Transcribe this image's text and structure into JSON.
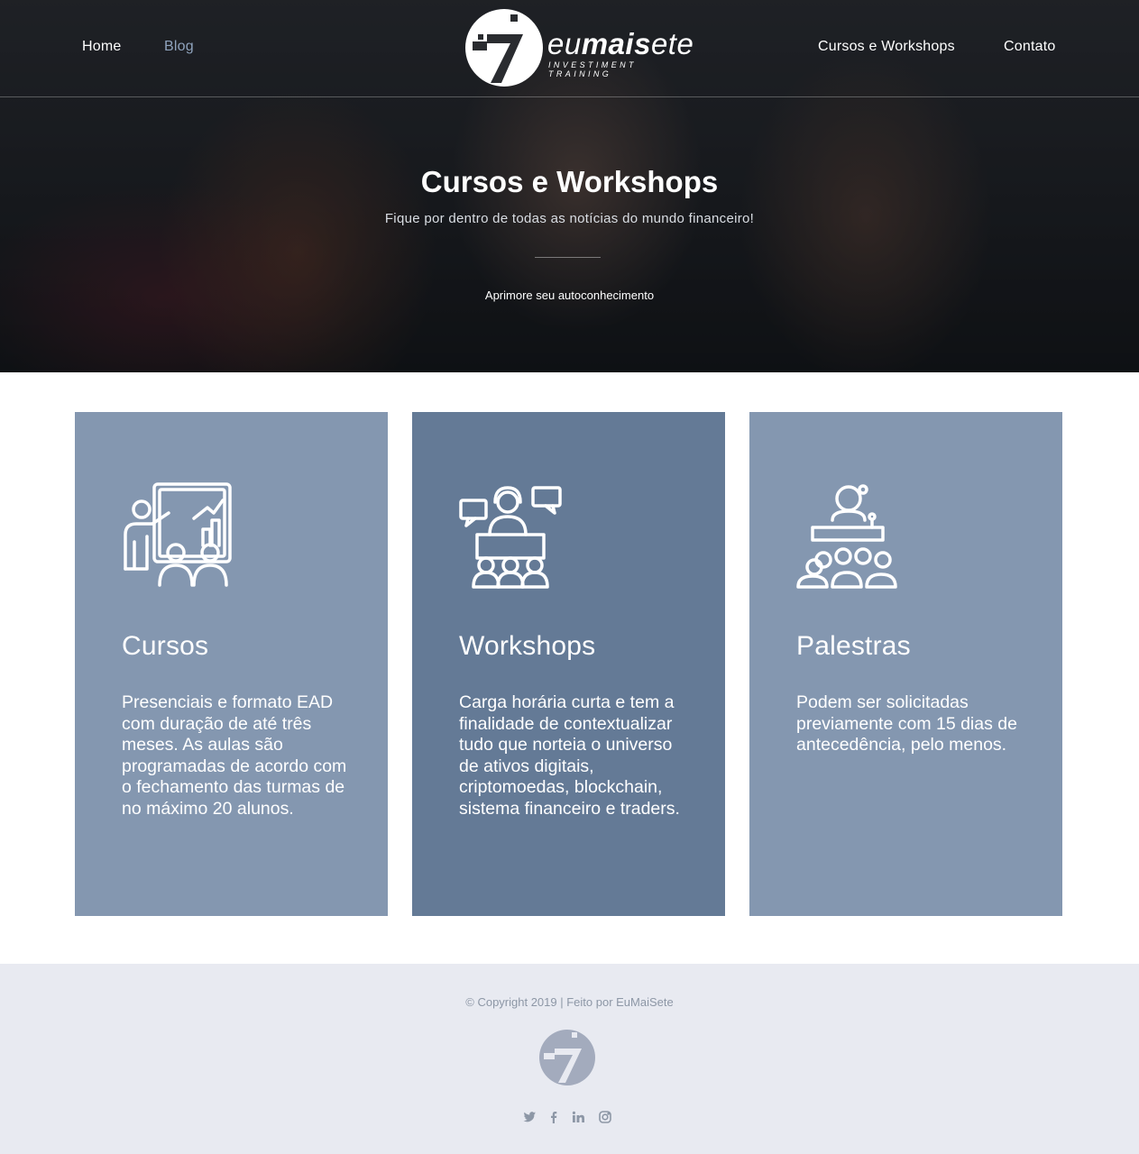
{
  "nav": {
    "items": [
      {
        "label": "Home"
      },
      {
        "label": "Blog"
      },
      {
        "label": "Cursos e Workshops"
      },
      {
        "label": "Contato"
      }
    ]
  },
  "logo": {
    "brand_light": "eu",
    "brand_bold": "mais",
    "brand_tail": "ete",
    "tagline": "INVESTIMENT TRAINING"
  },
  "hero": {
    "title_light": "Cursos e ",
    "title_bold": "Workshops",
    "subtitle": "Fique por dentro de todas as notícias do mundo financeiro!",
    "small": "Aprimore seu autoconhecimento"
  },
  "cards": [
    {
      "title": "Cursos",
      "text": "Presenciais e formato EAD com duração de até três meses. As aulas são programadas de acordo com o fechamento das turmas de no máximo 20 alunos.",
      "icon": "presentation-chart-icon"
    },
    {
      "title": "Workshops",
      "text": "Carga horária curta e tem a finalidade de contextualizar tudo que norteia o universo de ativos digitais, criptomoedas, blockchain, sistema financeiro e traders.",
      "icon": "workshop-discussion-icon"
    },
    {
      "title": "Palestras",
      "text": "Podem ser solicitadas previamente com 15 dias de antecedência, pelo menos.",
      "icon": "lecture-speaker-icon"
    }
  ],
  "footer": {
    "copyright": "© Copyright 2019 | Feito por EuMaiSete",
    "social": [
      "twitter-icon",
      "facebook-icon",
      "linkedin-icon",
      "instagram-icon"
    ]
  },
  "colors": {
    "card_light": "#8497b0",
    "card_dark": "#647a96",
    "footer_bg": "#e8eaf1",
    "nav_active": "#8fa3bd"
  }
}
